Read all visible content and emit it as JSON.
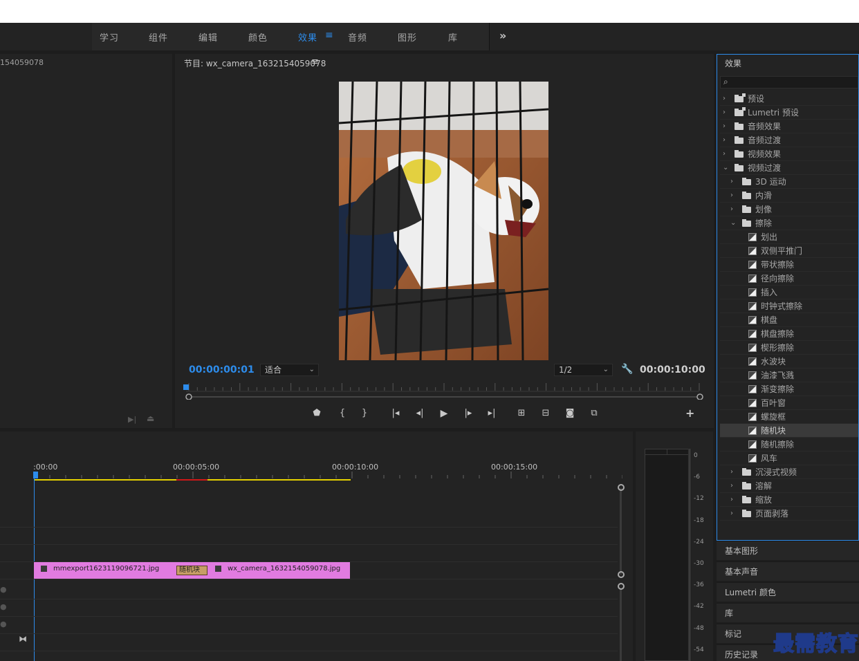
{
  "menu": {
    "items": [
      "学习",
      "组件",
      "编辑",
      "颜色",
      "效果",
      "音频",
      "图形",
      "库"
    ],
    "active": "效果",
    "more_icon": "double-chevron-right-icon"
  },
  "source": {
    "title_fragment": "154059078"
  },
  "program": {
    "title": "节目: wx_camera_1632154059078",
    "menu_icon": "hamburger-icon",
    "current_time": "00:00:00:01",
    "fit_option": "适合",
    "resolution": "1/2",
    "duration": "00:00:10:00",
    "playhead_progress": 0.0
  },
  "effects": {
    "title": "效果",
    "search_placeholder": "",
    "tree": [
      {
        "label": "预设",
        "level": 0,
        "kind": "preset",
        "expanded": false
      },
      {
        "label": "Lumetri 预设",
        "level": 0,
        "kind": "preset",
        "expanded": false
      },
      {
        "label": "音频效果",
        "level": 0,
        "kind": "folder",
        "expanded": false
      },
      {
        "label": "音频过渡",
        "level": 0,
        "kind": "folder",
        "expanded": false
      },
      {
        "label": "视频效果",
        "level": 0,
        "kind": "folder",
        "expanded": false
      },
      {
        "label": "视频过渡",
        "level": 0,
        "kind": "folder",
        "expanded": true
      },
      {
        "label": "3D 运动",
        "level": 1,
        "kind": "folder",
        "expanded": false
      },
      {
        "label": "内滑",
        "level": 1,
        "kind": "folder",
        "expanded": false
      },
      {
        "label": "划像",
        "level": 1,
        "kind": "folder",
        "expanded": false
      },
      {
        "label": "擦除",
        "level": 1,
        "kind": "folder",
        "expanded": true
      },
      {
        "label": "划出",
        "level": 2,
        "kind": "effect"
      },
      {
        "label": "双侧平推门",
        "level": 2,
        "kind": "effect"
      },
      {
        "label": "带状擦除",
        "level": 2,
        "kind": "effect"
      },
      {
        "label": "径向擦除",
        "level": 2,
        "kind": "effect"
      },
      {
        "label": "插入",
        "level": 2,
        "kind": "effect"
      },
      {
        "label": "时钟式擦除",
        "level": 2,
        "kind": "effect"
      },
      {
        "label": "棋盘",
        "level": 2,
        "kind": "effect"
      },
      {
        "label": "棋盘擦除",
        "level": 2,
        "kind": "effect"
      },
      {
        "label": "楔形擦除",
        "level": 2,
        "kind": "effect"
      },
      {
        "label": "水波块",
        "level": 2,
        "kind": "effect"
      },
      {
        "label": "油漆飞溅",
        "level": 2,
        "kind": "effect"
      },
      {
        "label": "渐变擦除",
        "level": 2,
        "kind": "effect"
      },
      {
        "label": "百叶窗",
        "level": 2,
        "kind": "effect"
      },
      {
        "label": "螺旋框",
        "level": 2,
        "kind": "effect"
      },
      {
        "label": "随机块",
        "level": 2,
        "kind": "effect",
        "selected": true
      },
      {
        "label": "随机擦除",
        "level": 2,
        "kind": "effect"
      },
      {
        "label": "风车",
        "level": 2,
        "kind": "effect"
      },
      {
        "label": "沉浸式视频",
        "level": 1,
        "kind": "folder",
        "expanded": false
      },
      {
        "label": "溶解",
        "level": 1,
        "kind": "folder",
        "expanded": false
      },
      {
        "label": "缩放",
        "level": 1,
        "kind": "folder",
        "expanded": false
      },
      {
        "label": "页面剥落",
        "level": 1,
        "kind": "folder",
        "expanded": false
      }
    ]
  },
  "side_tabs": [
    "基本图形",
    "基本声音",
    "Lumetri 颜色",
    "库",
    "标记",
    "历史记录"
  ],
  "timeline": {
    "ruler": [
      ":00:00",
      "00:00:05:00",
      "00:00:10:00",
      "00:00:15:00"
    ],
    "clips": [
      {
        "label": "mmexport1623119096721.jpg"
      },
      {
        "label": "wx_camera_1632154059078.jpg"
      }
    ],
    "transition_label": "随机块"
  },
  "meter": {
    "ticks": [
      "0",
      "-6",
      "-12",
      "-18",
      "-24",
      "-30",
      "-36",
      "-42",
      "-48",
      "-54"
    ]
  },
  "watermark": "最需教育",
  "colors": {
    "accent": "#2d8ceb",
    "clip": "#e17be0",
    "work_area": "#e6d200",
    "render_red": "#d01818"
  }
}
